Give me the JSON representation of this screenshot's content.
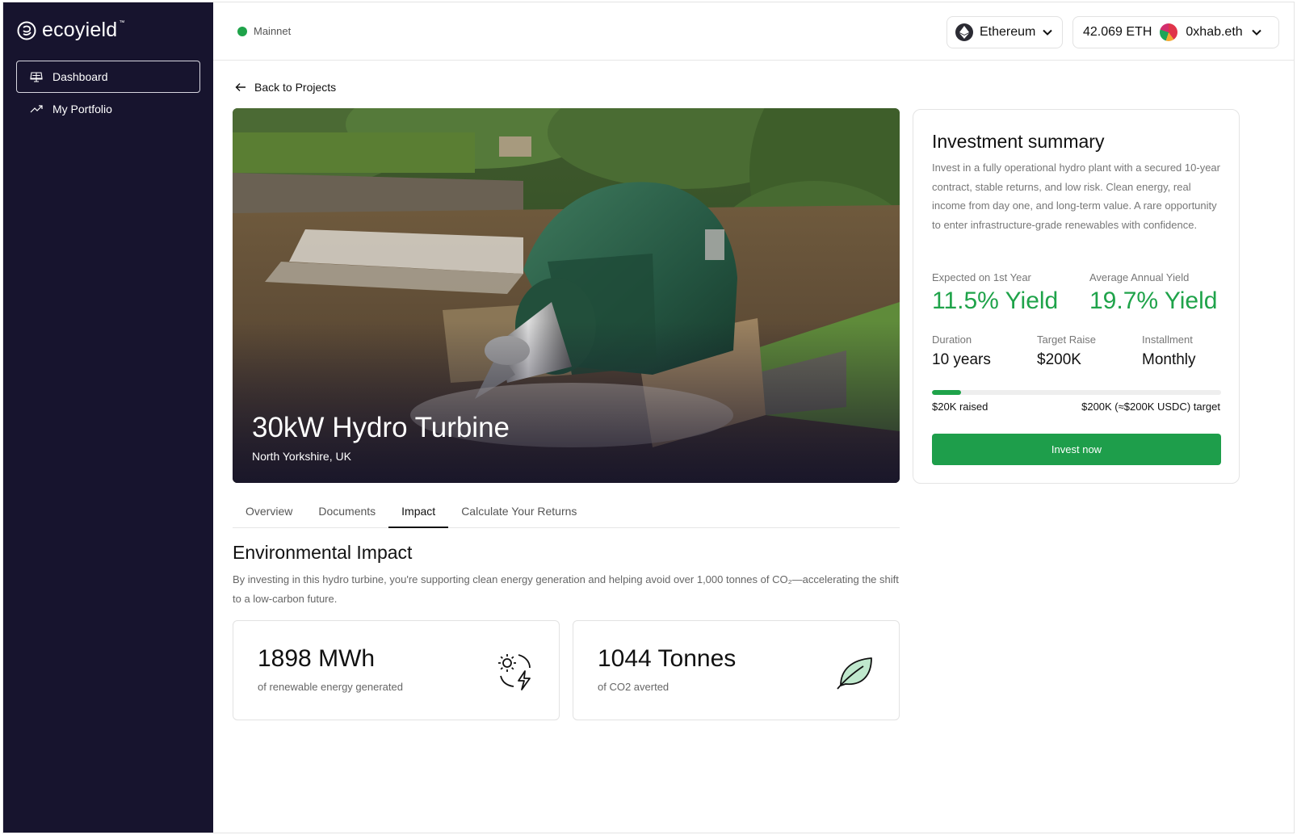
{
  "brand": {
    "name": "ecoyield",
    "tm": "™"
  },
  "sidebar": {
    "items": [
      {
        "label": "Dashboard",
        "icon": "solar-panel-icon",
        "active": true
      },
      {
        "label": "My Portfolio",
        "icon": "trend-up-icon",
        "active": false
      }
    ]
  },
  "topbar": {
    "network": "Mainnet",
    "network_color": "#1fa34a",
    "chain": "Ethereum",
    "balance": "42.069 ETH",
    "account": "0xhab.eth"
  },
  "back_label": "Back to Projects",
  "project": {
    "title": "30kW Hydro Turbine",
    "location": "North Yorkshire, UK"
  },
  "tabs": [
    {
      "label": "Overview",
      "active": false
    },
    {
      "label": "Documents",
      "active": false
    },
    {
      "label": "Impact",
      "active": true
    },
    {
      "label": "Calculate Your Returns",
      "active": false
    }
  ],
  "impact": {
    "title": "Environmental Impact",
    "description": "By investing in this hydro turbine, you're supporting clean energy generation and helping avoid over 1,000 tonnes of CO₂—accelerating the shift to a low-carbon future.",
    "cards": [
      {
        "value": "1898 MWh",
        "label": "of renewable energy generated",
        "icon": "sun-bolt-icon"
      },
      {
        "value": "1044 Tonnes",
        "label": "of CO2 averted",
        "icon": "leaf-icon"
      }
    ]
  },
  "summary": {
    "title": "Investment summary",
    "description": "Invest in a fully operational hydro plant with a secured 10-year contract, stable returns, and low risk. Clean energy, real income from day one, and long-term value. A rare opportunity to enter infrastructure-grade renewables with confidence.",
    "first_year_label": "Expected on 1st Year",
    "first_year_value": "11.5% Yield",
    "avg_label": "Average Annual Yield",
    "avg_value": "19.7% Yield",
    "duration_label": "Duration",
    "duration_value": "10 years",
    "target_label": "Target Raise",
    "target_value": "$200K",
    "installment_label": "Installment",
    "installment_value": "Monthly",
    "progress_fraction": 0.1,
    "raised_text": "$20K raised",
    "target_text": "$200K (≈$200K USDC) target",
    "cta": "Invest now",
    "accent": "#1fa34a"
  }
}
